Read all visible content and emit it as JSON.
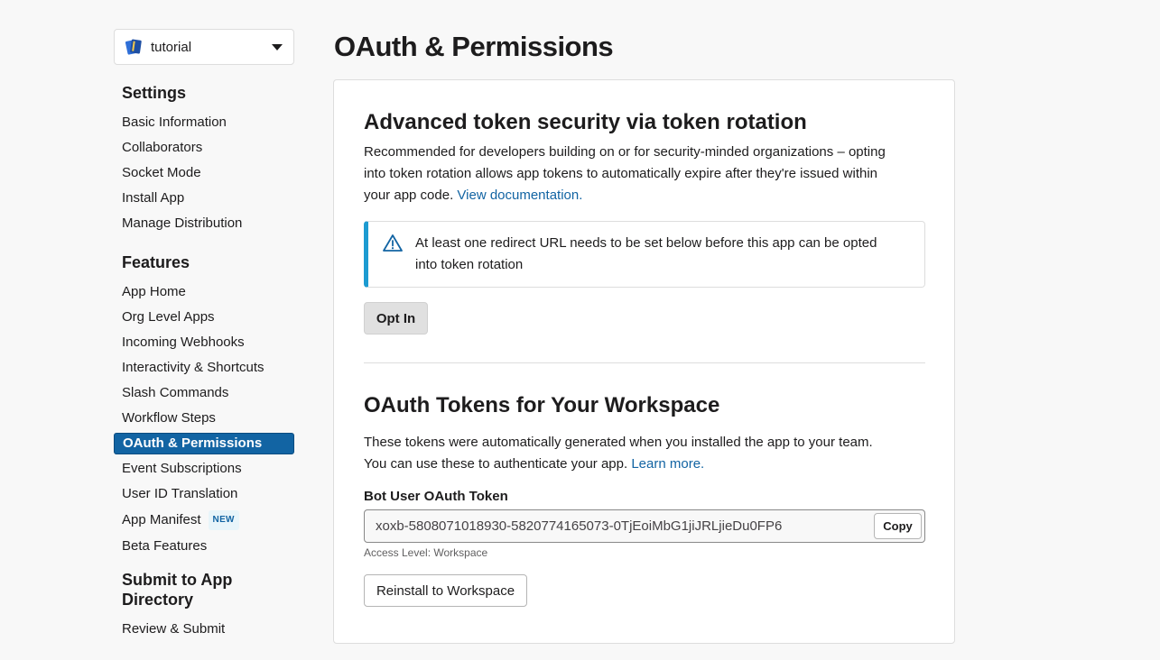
{
  "app_selector": {
    "name": "tutorial"
  },
  "sidebar": {
    "settings_heading": "Settings",
    "settings_items": [
      "Basic Information",
      "Collaborators",
      "Socket Mode",
      "Install App",
      "Manage Distribution"
    ],
    "features_heading": "Features",
    "features_items": [
      "App Home",
      "Org Level Apps",
      "Incoming Webhooks",
      "Interactivity & Shortcuts",
      "Slash Commands",
      "Workflow Steps",
      "OAuth & Permissions",
      "Event Subscriptions",
      "User ID Translation",
      "App Manifest",
      "Beta Features"
    ],
    "new_badge": "NEW",
    "submit_heading_line1": "Submit to App",
    "submit_heading_line2": "Directory",
    "submit_items": [
      "Review & Submit"
    ]
  },
  "page_title": "OAuth & Permissions",
  "token_rotation": {
    "heading": "Advanced token security via token rotation",
    "description_line1": "Recommended for developers building on or for security-minded organizations – opting",
    "description_line2": "into token rotation allows app tokens to automatically expire after they're issued within",
    "description_line3_prefix": "your app code. ",
    "doc_link": "View documentation.",
    "alert_line1": "At least one redirect URL needs to be set below before this app can be opted",
    "alert_line2": "into token rotation",
    "opt_in_button": "Opt In"
  },
  "oauth_tokens": {
    "heading": "OAuth Tokens for Your Workspace",
    "description_line1": "These tokens were automatically generated when you installed the app to your team.",
    "description_line2_prefix": "You can use these to authenticate your app. ",
    "learn_more_link": "Learn more.",
    "bot_token_label": "Bot User OAuth Token",
    "bot_token_value": "xoxb-5808071018930-5820774165073-0TjEoiMbG1jiJRLjieDu0FP6",
    "copy_button": "Copy",
    "access_level": "Access Level: Workspace",
    "reinstall_button": "Reinstall to Workspace"
  },
  "colors": {
    "accent": "#1264a3",
    "alert_border": "#1d9bd1"
  }
}
